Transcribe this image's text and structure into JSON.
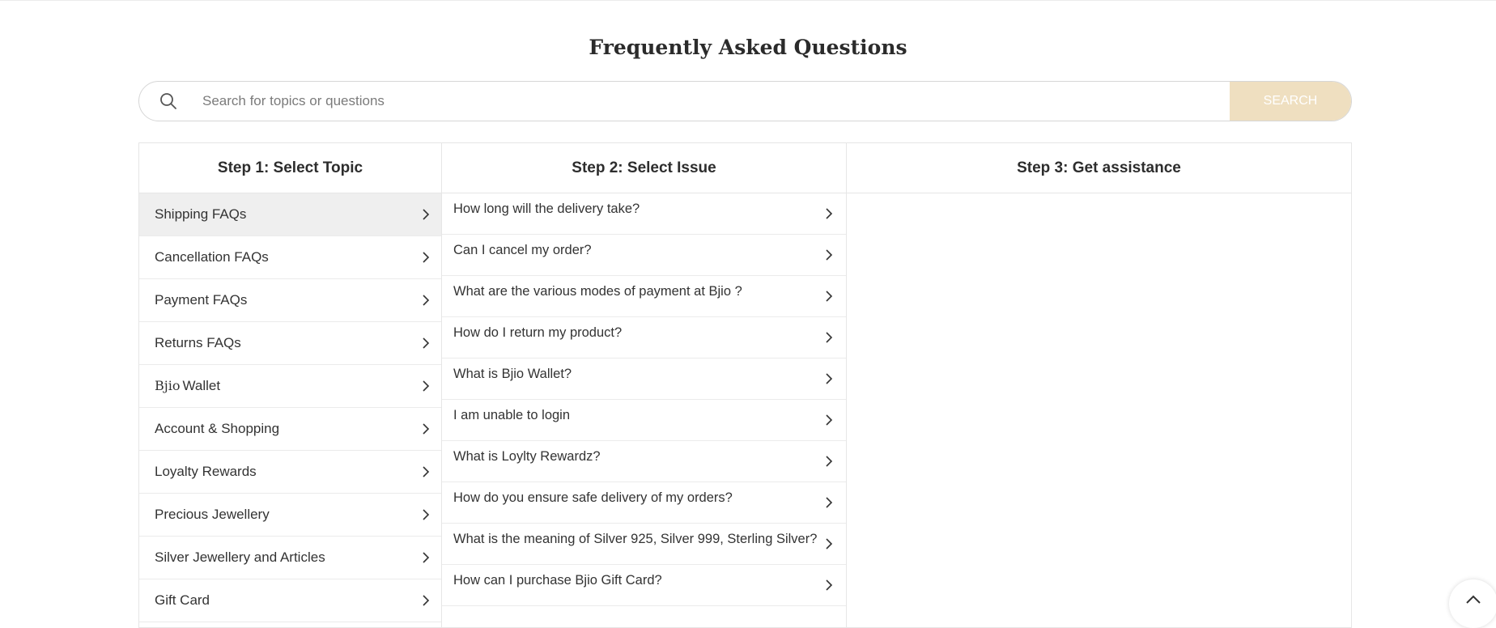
{
  "header": {
    "title": "Frequently Asked Questions"
  },
  "search": {
    "placeholder": "Search for topics or questions",
    "value": "",
    "button_label": "SEARCH"
  },
  "steps": {
    "step1_title": "Step 1: Select Topic",
    "step2_title": "Step 2: Select Issue",
    "step3_title": "Step 3: Get assistance"
  },
  "brand_mark": "Bjio",
  "topics": [
    {
      "label": "Shipping FAQs",
      "active": true
    },
    {
      "label": "Cancellation FAQs"
    },
    {
      "label": "Payment FAQs"
    },
    {
      "label": "Returns FAQs"
    },
    {
      "label": "Wallet",
      "brand_prefix": "Bjio"
    },
    {
      "label": "Account & Shopping"
    },
    {
      "label": "Loyalty Rewards"
    },
    {
      "label": "Precious Jewellery"
    },
    {
      "label": "Silver Jewellery and Articles"
    },
    {
      "label": "Gift Card"
    }
  ],
  "issues": [
    {
      "label": "How long will the delivery take?"
    },
    {
      "label": "Can I cancel my order?"
    },
    {
      "label": "What are the various modes of payment at Bjio ?"
    },
    {
      "label": "How do I return my product?"
    },
    {
      "label": "What is Bjio Wallet?"
    },
    {
      "label": "I am unable to login"
    },
    {
      "label": "What is Loylty Rewardz?"
    },
    {
      "label": "How do you ensure safe delivery of my orders?"
    },
    {
      "label": "What is the meaning of Silver 925, Silver 999, Sterling Silver?"
    },
    {
      "label": "How can I purchase Bjio Gift Card?"
    }
  ],
  "icons": {
    "search": "search-icon",
    "chevron": "chevron-right-icon",
    "scroll_top": "chevron-up-icon"
  },
  "colors": {
    "search_button": "#efdfc0",
    "active_topic": "#efefef",
    "border": "#e6e6e6"
  }
}
